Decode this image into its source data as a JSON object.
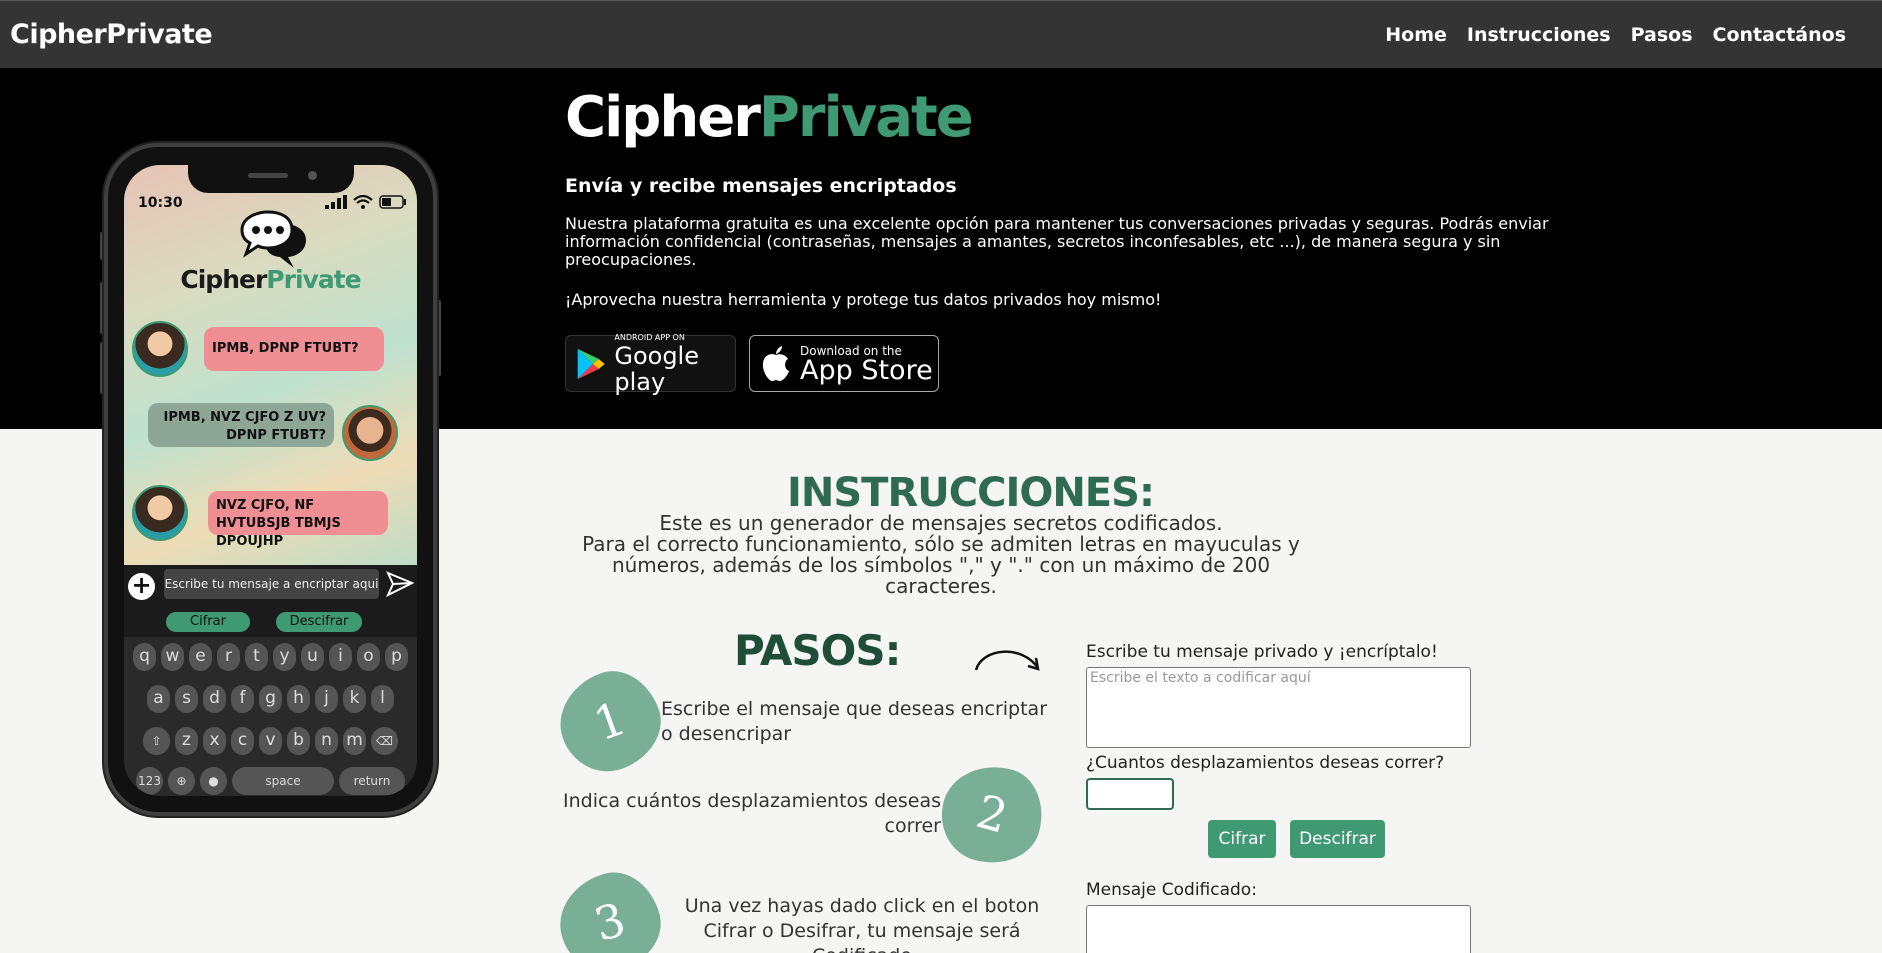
{
  "navbar": {
    "brand": "CipherPrivate",
    "links": [
      "Home",
      "Instrucciones",
      "Pasos",
      "Contactános"
    ]
  },
  "hero": {
    "logo_part1": "Cipher",
    "logo_part2": "Private",
    "title": "Envía y recibe mensajes encriptados",
    "description": "Nuestra plataforma gratuita es una excelente opción para mantener tus conversaciones privadas y seguras. Podrás enviar información confidencial (contraseñas, mensajes a amantes, secretos inconfesables, etc ...), de manera segura y sin preocupaciones.",
    "cta": "¡Aprovecha nuestra herramienta y protege tus datos privados hoy mismo!",
    "google_play_small": "ANDROID APP ON",
    "google_play_big": "Google play",
    "app_store_small": "Download on the",
    "app_store_big": "App Store"
  },
  "phone": {
    "time": "10:30",
    "logo_part1": "Cipher",
    "logo_part2": "Private",
    "messages": [
      {
        "text": "IPMB, DPNP FTUBT?"
      },
      {
        "text": "IPMB, NVZ CJFO Z UV? DPNP FTUBT?"
      },
      {
        "text": "NVZ CJFO, NF HVTUBSJB TBMJS DPOUJHP"
      }
    ],
    "input_placeholder": "Escribe tu mensaje a encriptar aqui",
    "btn_cifrar": "Cifrar",
    "btn_descifrar": "Descifrar",
    "keyboard": {
      "row1": [
        "q",
        "w",
        "e",
        "r",
        "t",
        "y",
        "u",
        "i",
        "o",
        "p"
      ],
      "row2": [
        "a",
        "s",
        "d",
        "f",
        "g",
        "h",
        "j",
        "k",
        "l"
      ],
      "row3": [
        "z",
        "x",
        "c",
        "v",
        "b",
        "n",
        "m"
      ],
      "num": "123",
      "space": "space",
      "return": "return"
    }
  },
  "instrucciones": {
    "title": "INSTRUCCIONES:",
    "line1": "Este es un generador de mensajes secretos codificados.",
    "line2": "Para el correcto funcionamiento, sólo se admiten letras en mayuculas y números, además de los símbolos \",\" y \".\" con un máximo de 200 caracteres."
  },
  "pasos": {
    "title": "PASOS:",
    "steps": [
      {
        "num": "1",
        "text": "Escribe el mensaje que deseas encriptar o desencripar"
      },
      {
        "num": "2",
        "text": "Indica cuántos desplazamientos deseas correr"
      },
      {
        "num": "3",
        "text": "Una vez hayas dado click en el boton Cifrar o Desifrar, tu mensaje será Codificado"
      }
    ]
  },
  "form": {
    "message_label": "Escribe tu mensaje privado y ¡encríptalo!",
    "message_placeholder": "Escribe el texto a codificar aquí",
    "shift_label": "¿Cuantos desplazamientos deseas correr?",
    "btn_cifrar": "Cifrar",
    "btn_descifrar": "Descifrar",
    "output_label": "Mensaje Codificado:"
  },
  "colors": {
    "accent": "#3f9a73",
    "dark_green": "#2f6b52",
    "navbar": "#343434"
  }
}
